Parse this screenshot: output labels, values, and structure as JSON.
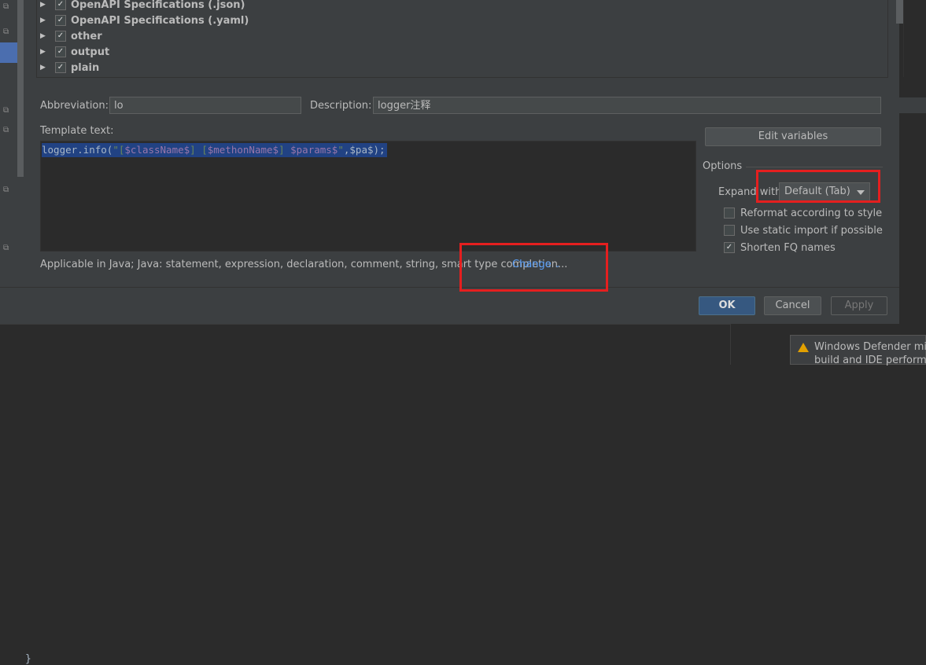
{
  "tree": {
    "items": [
      {
        "label": "OpenAPI Specifications (.json)",
        "checked": true
      },
      {
        "label": "OpenAPI Specifications (.yaml)",
        "checked": true
      },
      {
        "label": "other",
        "checked": true
      },
      {
        "label": "output",
        "checked": true
      },
      {
        "label": "plain",
        "checked": true
      }
    ]
  },
  "form": {
    "abbreviation_label": "Abbreviation:",
    "abbreviation_value": "lo",
    "description_label": "Description:",
    "description_value": "logger注释",
    "template_label": "Template text:",
    "template": {
      "part1": "logger.info(",
      "part2": "\"[",
      "part3": "$className$",
      "part4": "] [",
      "part5": "$methonName$",
      "part6": "] ",
      "part7": "$params$",
      "part8": "\"",
      "part9": ",$pa$);"
    },
    "applicable_text": "Applicable in Java; Java: statement, expression, declaration, comment, string, smart type completion...",
    "change_link": "Change"
  },
  "options": {
    "edit_variables_label": "Edit variables",
    "title": "Options",
    "expand_with_label": "Expand with",
    "expand_with_value": "Default (Tab)",
    "reformat_label": "Reformat according to style",
    "reformat_checked": false,
    "static_import_label": "Use static import if possible",
    "static_import_checked": false,
    "shorten_fq_label": "Shorten FQ names",
    "shorten_fq_checked": true
  },
  "footer": {
    "ok_label": "OK",
    "cancel_label": "Cancel",
    "apply_label": "Apply"
  },
  "editor": {
    "brace": "}"
  },
  "notification": {
    "line1": "Windows Defender migh",
    "line2": "build and IDE performar"
  },
  "colors": {
    "dialog_bg": "#3c3f41",
    "editor_bg": "#2b2b2b",
    "selection": "#214283",
    "ok_button": "#365880",
    "link": "#589df6",
    "highlight_box": "#e51f1f",
    "warning": "#e2a000"
  }
}
